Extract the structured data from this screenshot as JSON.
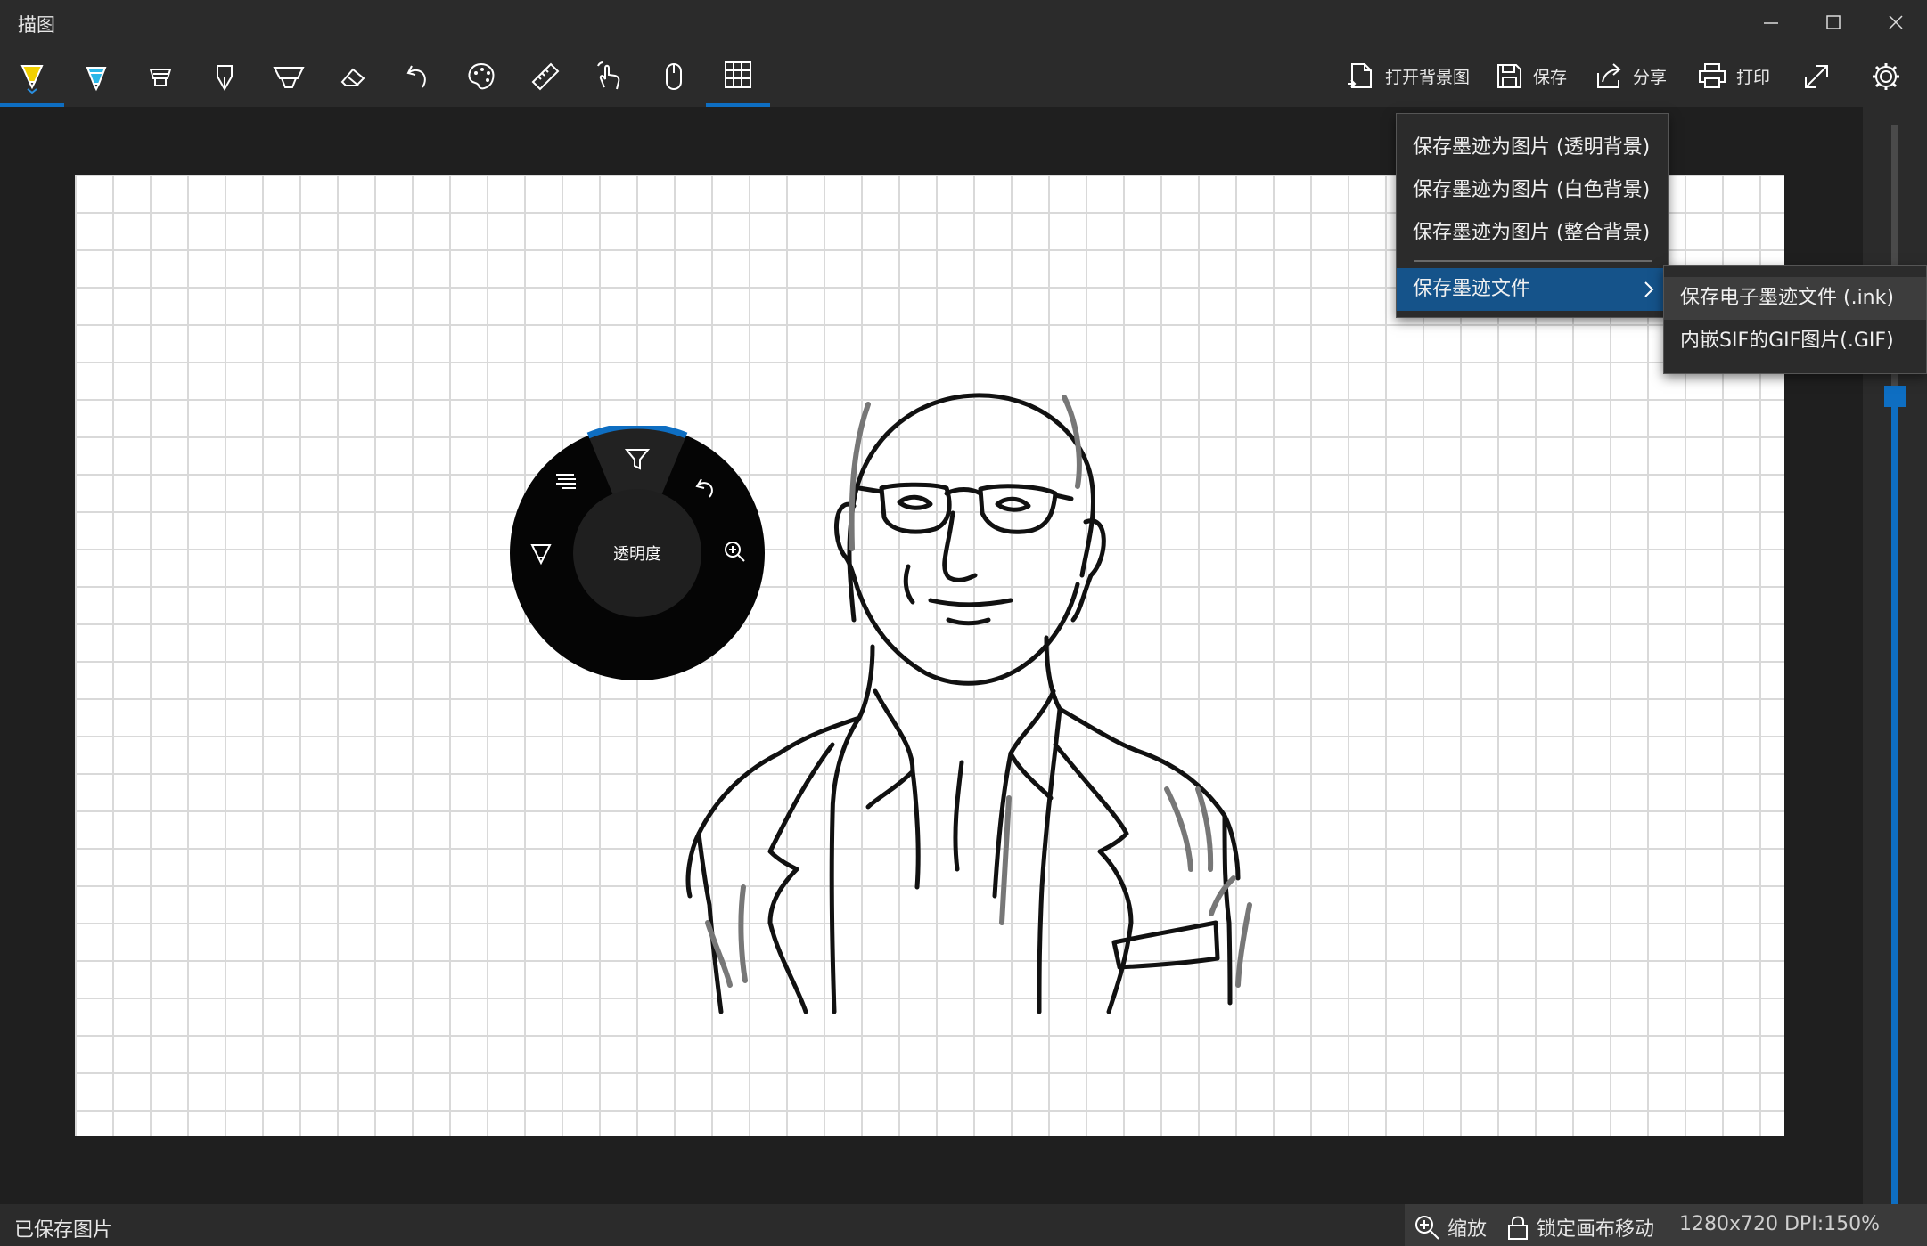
{
  "window": {
    "title": "描图"
  },
  "toolbar": {
    "tools": [
      {
        "name": "ballpoint-pen-icon",
        "color": "#f2d000"
      },
      {
        "name": "pencil-icon",
        "color": "#2ab7e8"
      },
      {
        "name": "highlighter-icon"
      },
      {
        "name": "calligraphy-pen-icon"
      },
      {
        "name": "brush-icon"
      },
      {
        "name": "eraser-icon"
      },
      {
        "name": "undo-icon"
      },
      {
        "name": "palette-icon"
      },
      {
        "name": "ruler-icon"
      },
      {
        "name": "touch-draw-icon"
      },
      {
        "name": "mouse-icon"
      },
      {
        "name": "grid-icon"
      }
    ],
    "open_background": "打开背景图",
    "save": "保存",
    "share": "分享",
    "print": "打印"
  },
  "save_menu": {
    "items": [
      "保存墨迹为图片 (透明背景)",
      "保存墨迹为图片 (白色背景)",
      "保存墨迹为图片 (整合背景)"
    ],
    "ink_file": "保存墨迹文件",
    "submenu": [
      "保存电子墨迹文件 (.ink)",
      "内嵌SIF的GIF图片(.GIF)"
    ]
  },
  "radial_dial": {
    "center_label": "透明度"
  },
  "statusbar": {
    "message": "已保存图片",
    "zoom": "缩放",
    "lock": "锁定画布移动",
    "info": "1280x720 DPI:150%"
  },
  "slider": {
    "value_percent": 0.75
  },
  "colors": {
    "accent": "#0e6ec2",
    "menu_highlight": "#15538a"
  }
}
